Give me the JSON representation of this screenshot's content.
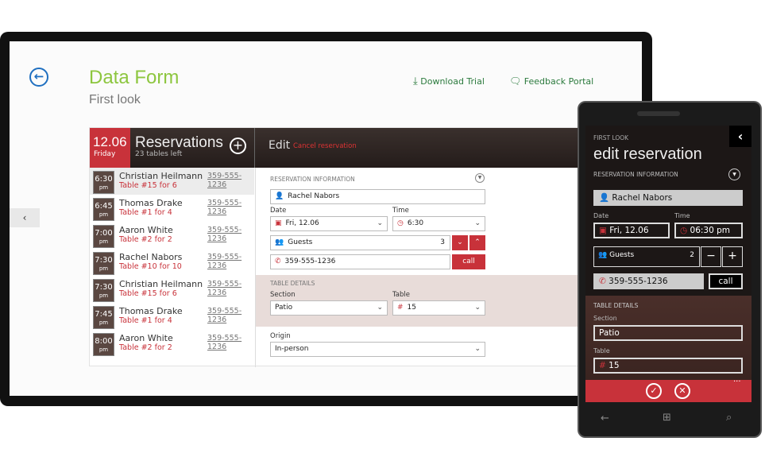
{
  "header": {
    "title": "Data Form",
    "subtitle": "First look",
    "download_trial": "Download Trial",
    "feedback_portal": "Feedback Portal"
  },
  "colors": {
    "accent": "#c8323a",
    "title": "#8dc63f",
    "link": "#2b7a3d"
  },
  "app": {
    "date": "12.06",
    "day": "Friday",
    "title": "Reservations",
    "tables_left": "23 tables left",
    "edit": "Edit",
    "cancel": "Cancel reservation"
  },
  "list": [
    {
      "time": "6:30",
      "ampm": "pm",
      "name": "Christian Heilmann",
      "table": "Table #15 for 6",
      "phone": "359-555-1236"
    },
    {
      "time": "6:45",
      "ampm": "pm",
      "name": "Thomas Drake",
      "table": "Table #1 for 4",
      "phone": "359-555-1236"
    },
    {
      "time": "7:00",
      "ampm": "pm",
      "name": "Aaron White",
      "table": "Table #2 for 2",
      "phone": "359-555-1236"
    },
    {
      "time": "7:30",
      "ampm": "pm",
      "name": "Rachel Nabors",
      "table": "Table #10 for 10",
      "phone": "359-555-1236"
    },
    {
      "time": "7:30",
      "ampm": "pm",
      "name": "Christian Heilmann",
      "table": "Table #15 for 6",
      "phone": "359-555-1236"
    },
    {
      "time": "7:45",
      "ampm": "pm",
      "name": "Thomas Drake",
      "table": "Table #1 for 4",
      "phone": "359-555-1236"
    },
    {
      "time": "8:00",
      "ampm": "pm",
      "name": "Aaron White",
      "table": "Table #2 for 2",
      "phone": "359-555-1236"
    }
  ],
  "form": {
    "res_info": "RESERVATION INFORMATION",
    "name": "Rachel Nabors",
    "date_label": "Date",
    "date": "Fri, 12.06",
    "time_label": "Time",
    "time": "6:30",
    "guests_label": "Guests",
    "guests": "3",
    "phone": "359-555-1236",
    "call": "call",
    "table_details": "TABLE DETAILS",
    "section_label": "Section",
    "section": "Patio",
    "table_label": "Table",
    "table": "15",
    "origin_label": "Origin",
    "origin": "In-person"
  },
  "phone": {
    "app": "FIRST LOOK",
    "title": "edit reservation",
    "res_info": "RESERVATION INFORMATION",
    "name": "Rachel Nabors",
    "date_label": "Date",
    "date": "Fri, 12.06",
    "time_label": "Time",
    "time": "06:30 pm",
    "guests_label": "Guests",
    "guests": "2",
    "phone": "359-555-1236",
    "call": "call",
    "table_details": "TABLE DETAILS",
    "section_label": "Section",
    "section": "Patio",
    "table_label": "Table",
    "table": "15",
    "more": "..."
  }
}
